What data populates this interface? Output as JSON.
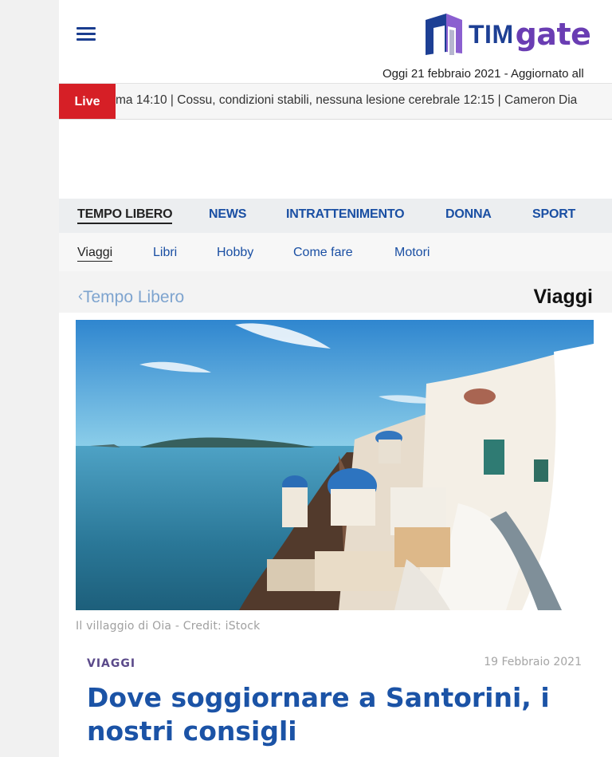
{
  "header": {
    "menu_icon": "hamburger-menu-icon",
    "logo_text_tim": "TIM",
    "logo_text_gate": "gate",
    "date_text": "Oggi 21 febbraio 2021 - Aggiornato all",
    "brand_colors": {
      "tim": "#1d3f94",
      "gate": "#6a3db3"
    }
  },
  "ticker": {
    "live_label": "Live",
    "text": "ma   14:10 | Cossu, condizioni stabili, nessuna lesione cerebrale   12:15 | Cameron Dia",
    "live_color": "#d61f26"
  },
  "nav": {
    "main": [
      {
        "label": "TEMPO LIBERO",
        "active": true
      },
      {
        "label": "NEWS",
        "active": false
      },
      {
        "label": "INTRATTENIMENTO",
        "active": false
      },
      {
        "label": "DONNA",
        "active": false
      },
      {
        "label": "SPORT",
        "active": false
      }
    ],
    "sub": [
      {
        "label": "Viaggi",
        "active": true
      },
      {
        "label": "Libri",
        "active": false
      },
      {
        "label": "Hobby",
        "active": false
      },
      {
        "label": "Come fare",
        "active": false
      },
      {
        "label": "Motori",
        "active": false
      }
    ]
  },
  "breadcrumb": {
    "back_icon": "chevron-left-icon",
    "back_label": "Tempo Libero",
    "section_title": "Viaggi"
  },
  "article": {
    "caption": "Il villaggio di Oia - Credit: iStock",
    "category": "VIAGGI",
    "date": "19 Febbraio 2021",
    "title": "Dove soggiornare a Santorini, i nostri consigli"
  }
}
